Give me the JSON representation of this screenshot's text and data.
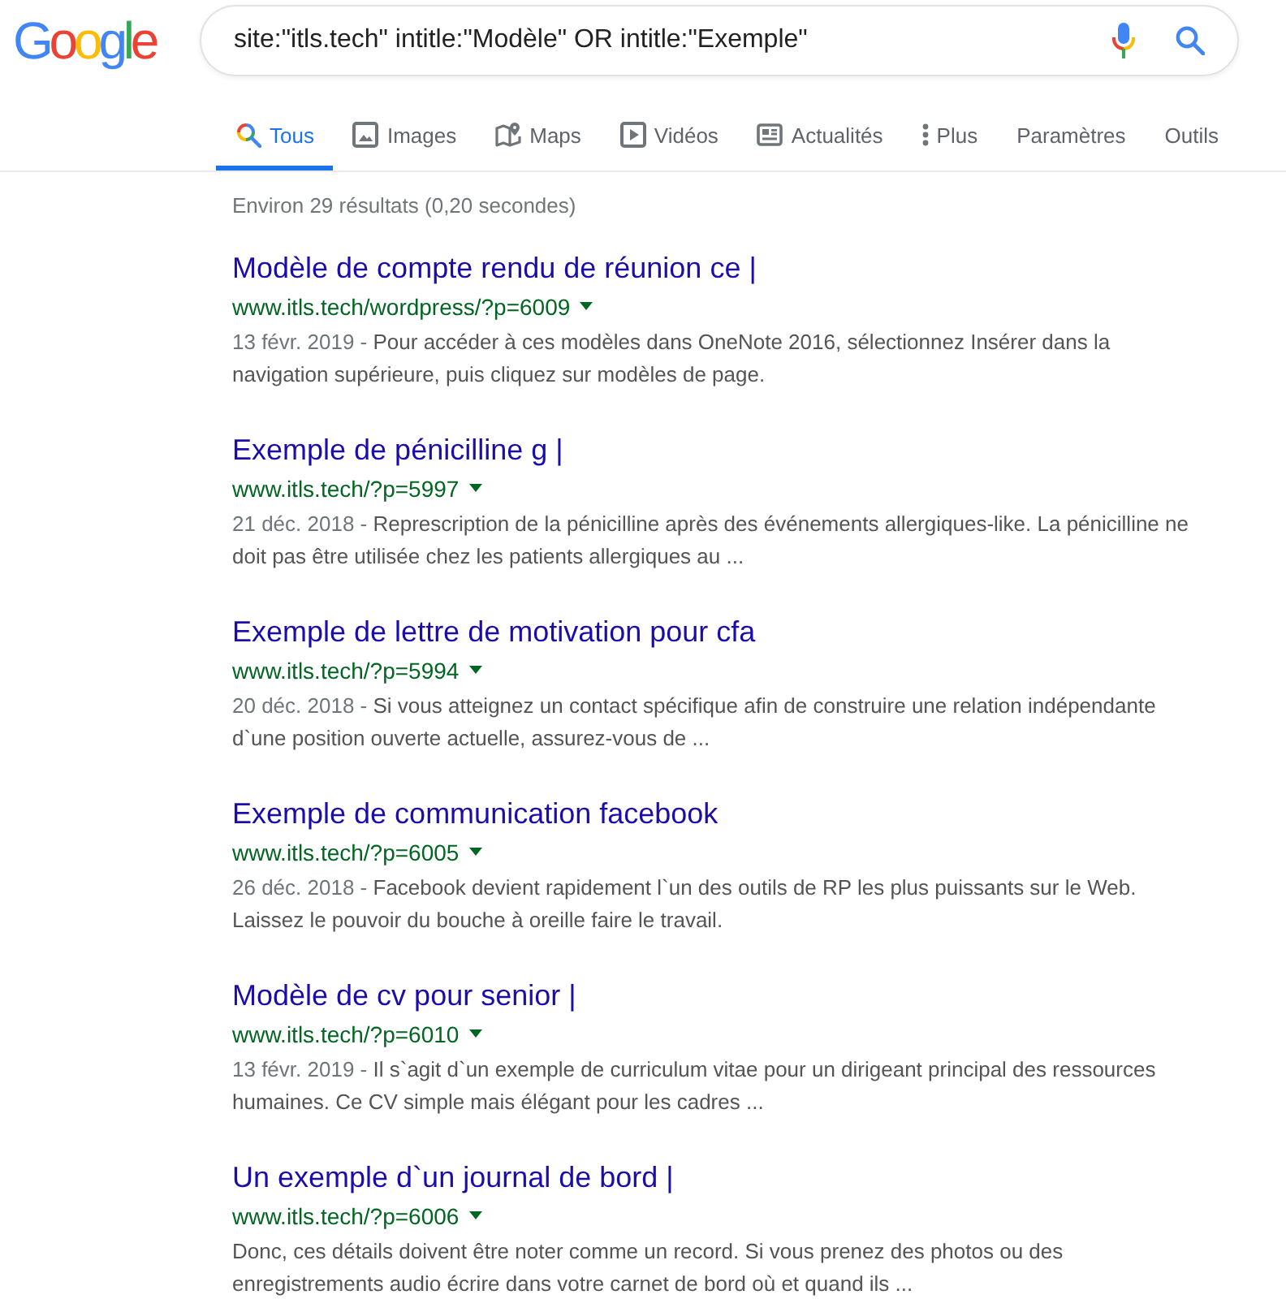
{
  "logo": "Google",
  "search": {
    "value": "site:\"itls.tech\" intitle:\"Modèle\" OR intitle:\"Exemple\""
  },
  "tabs": [
    {
      "kind": "all",
      "label": "Tous",
      "selected": true
    },
    {
      "kind": "images",
      "label": "Images",
      "selected": false
    },
    {
      "kind": "maps",
      "label": "Maps",
      "selected": false
    },
    {
      "kind": "videos",
      "label": "Vidéos",
      "selected": false
    },
    {
      "kind": "news",
      "label": "Actualités",
      "selected": false
    },
    {
      "kind": "more",
      "label": "Plus",
      "selected": false
    }
  ],
  "tools": [
    "Paramètres",
    "Outils"
  ],
  "stats": "Environ 29 résultats (0,20 secondes)",
  "results": [
    {
      "title": "Modèle de compte rendu de réunion ce |",
      "url": "www.itls.tech/wordpress/?p=6009",
      "date": "13 févr. 2019 -",
      "snippet": "Pour accéder à ces modèles dans OneNote 2016, sélectionnez Insérer dans la navigation supérieure, puis cliquez sur modèles de page."
    },
    {
      "title": "Exemple de pénicilline g |",
      "url": "www.itls.tech/?p=5997",
      "date": "21 déc. 2018 -",
      "snippet": "Represcription de la pénicilline après des événements allergiques-like. La pénicilline ne doit pas être utilisée chez les patients allergiques au ..."
    },
    {
      "title": "Exemple de lettre de motivation pour cfa",
      "url": "www.itls.tech/?p=5994",
      "date": "20 déc. 2018 -",
      "snippet": "Si vous atteignez un contact spécifique afin de construire une relation indépendante d`une position ouverte actuelle, assurez-vous de ..."
    },
    {
      "title": "Exemple de communication facebook",
      "url": "www.itls.tech/?p=6005",
      "date": "26 déc. 2018 -",
      "snippet": "Facebook devient rapidement l`un des outils de RP les plus puissants sur le Web. Laissez le pouvoir du bouche à oreille faire le travail."
    },
    {
      "title": "Modèle de cv pour senior |",
      "url": "www.itls.tech/?p=6010",
      "date": "13 févr. 2019 -",
      "snippet": "Il s`agit d`un exemple de curriculum vitae pour un dirigeant principal des ressources humaines. Ce CV simple mais élégant pour les cadres ..."
    },
    {
      "title": "Un exemple d`un journal de bord |",
      "url": "www.itls.tech/?p=6006",
      "snippet": "Donc, ces détails doivent être noter comme un record. Si vous prenez des photos ou des enregistrements audio écrire dans votre carnet de bord où et quand ils ..."
    }
  ]
}
